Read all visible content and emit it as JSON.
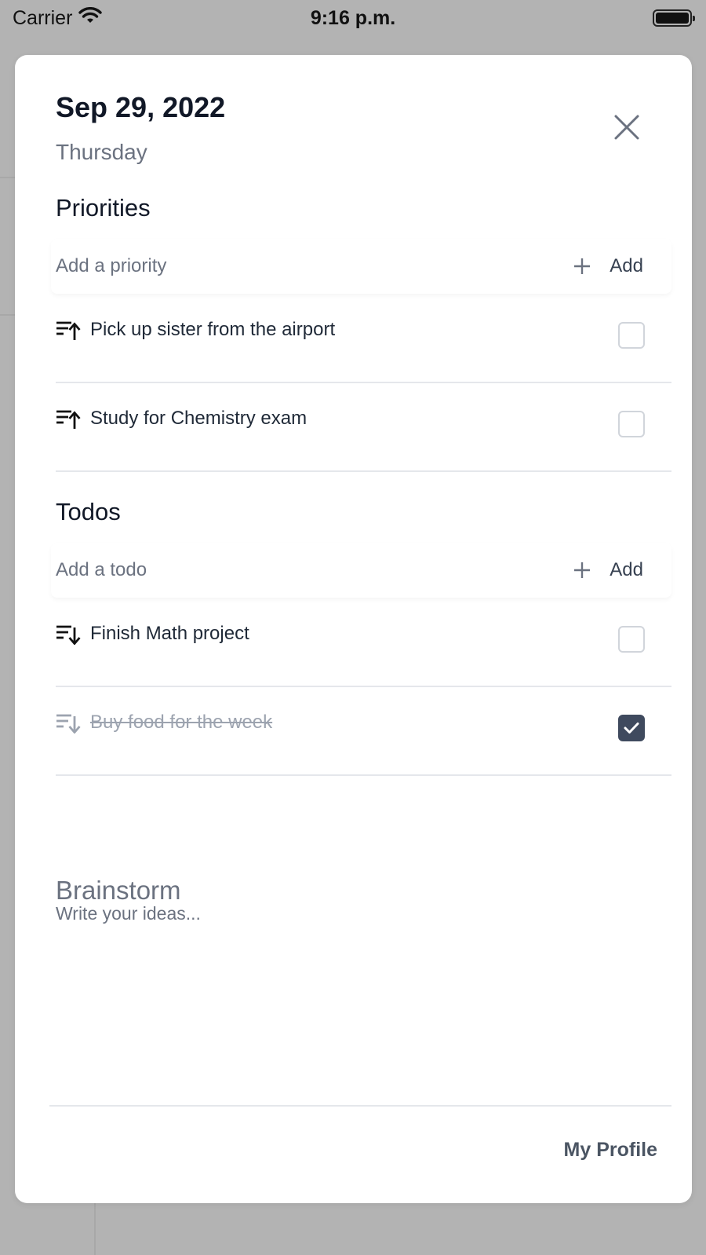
{
  "status_bar": {
    "carrier": "Carrier",
    "time": "9:16 p.m.",
    "wifi_icon": "wifi-icon",
    "battery_icon": "battery-full-icon"
  },
  "header": {
    "date": "Sep 29, 2022",
    "weekday": "Thursday",
    "close_icon": "close-icon"
  },
  "priorities": {
    "title": "Priorities",
    "add_placeholder": "Add a priority",
    "add_label": "Add",
    "items": [
      {
        "text": "Pick up sister from the airport",
        "icon": "sort-ascending-icon",
        "checked": false
      },
      {
        "text": "Study for Chemistry exam",
        "icon": "sort-ascending-icon",
        "checked": false
      }
    ]
  },
  "todos": {
    "title": "Todos",
    "add_placeholder": "Add a todo",
    "add_label": "Add",
    "items": [
      {
        "text": "Finish Math project",
        "icon": "sort-descending-icon",
        "checked": false
      },
      {
        "text": "Buy food for the week",
        "icon": "sort-descending-icon",
        "checked": true
      }
    ]
  },
  "brainstorm": {
    "title": "Brainstorm",
    "placeholder": "Write your ideas..."
  },
  "footer": {
    "profile_label": "My Profile"
  },
  "colors": {
    "checkbox_checked": "#3f4a5e",
    "muted_text": "#6b7280",
    "primary_text": "#111827"
  }
}
